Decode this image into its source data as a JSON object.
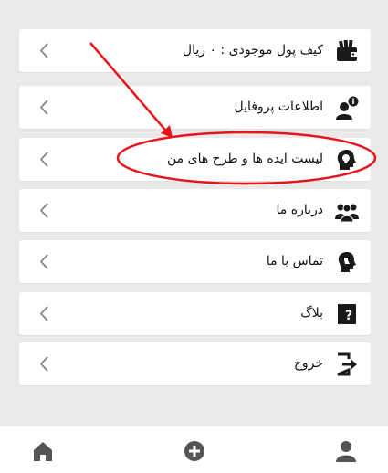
{
  "menu": {
    "items": [
      {
        "label": "کیف پول  موجودی : ۰ ریال",
        "icon": "wallet-icon"
      },
      {
        "label": "اطلاعات پروفایل",
        "icon": "user-info-icon"
      },
      {
        "label": "لیست ایده ها و طرح های من",
        "icon": "lightbulb-head-icon"
      },
      {
        "label": "درباره ما",
        "icon": "group-icon"
      },
      {
        "label": "تماس با ما",
        "icon": "support-head-icon"
      },
      {
        "label": "بلاگ",
        "icon": "question-book-icon"
      },
      {
        "label": "خروج",
        "icon": "exit-icon"
      }
    ]
  },
  "bottom_nav": {
    "items": [
      {
        "name": "home",
        "icon": "home-icon"
      },
      {
        "name": "add",
        "icon": "add-circle-icon"
      },
      {
        "name": "profile",
        "icon": "person-icon"
      }
    ]
  },
  "colors": {
    "background": "#eaeaea",
    "card": "#ffffff",
    "icon": "#1a1a1a",
    "chevron": "#888888",
    "annotation": "#e8141c",
    "bottom_icons": "#555555"
  }
}
